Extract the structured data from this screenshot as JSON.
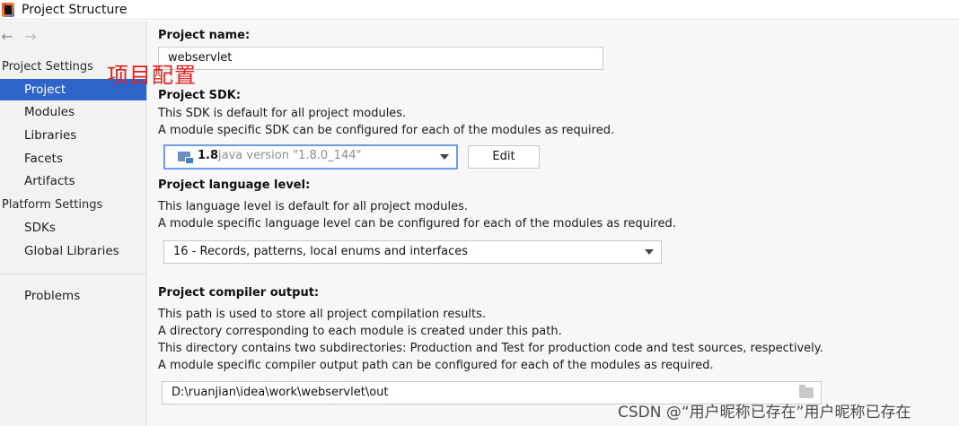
{
  "window": {
    "title": "Project Structure"
  },
  "nav": {
    "back": "←",
    "forward": "→"
  },
  "sidebar": {
    "project_settings_label": "Project Settings",
    "project_settings_items": [
      {
        "label": "Project",
        "selected": true
      },
      {
        "label": "Modules"
      },
      {
        "label": "Libraries"
      },
      {
        "label": "Facets"
      },
      {
        "label": "Artifacts"
      }
    ],
    "platform_settings_label": "Platform Settings",
    "platform_settings_items": [
      {
        "label": "SDKs"
      },
      {
        "label": "Global Libraries"
      }
    ],
    "problems_label": "Problems"
  },
  "annotation": {
    "text": "项目配置",
    "color": "#e3211c"
  },
  "main": {
    "project_name": {
      "heading": "Project name:",
      "value": "webservlet"
    },
    "project_sdk": {
      "heading": "Project SDK:",
      "desc_line1": "This SDK is default for all project modules.",
      "desc_line2": "A module specific SDK can be configured for each of the modules as required.",
      "selected_version": "1.8",
      "selected_desc": "java version \"1.8.0_144\"",
      "edit_button": "Edit"
    },
    "language_level": {
      "heading": "Project language level:",
      "desc_line1": "This language level is default for all project modules.",
      "desc_line2": "A module specific language level can be configured for each of the modules as required.",
      "selected": "16 - Records, patterns, local enums and interfaces"
    },
    "compiler_output": {
      "heading": "Project compiler output:",
      "desc_line1": "This path is used to store all project compilation results.",
      "desc_line2": "A directory corresponding to each module is created under this path.",
      "desc_line3": "This directory contains two subdirectories: Production and Test for production code and test sources, respectively.",
      "desc_line4": "A module specific compiler output path can be configured for each of the modules as required.",
      "path": "D:\\ruanjian\\idea\\work\\webservlet\\out"
    }
  },
  "watermark": "CSDN @“用户昵称已存在”用户昵称已存在",
  "colors": {
    "selection": "#2f65ca",
    "focus_border": "#6f9be6"
  }
}
